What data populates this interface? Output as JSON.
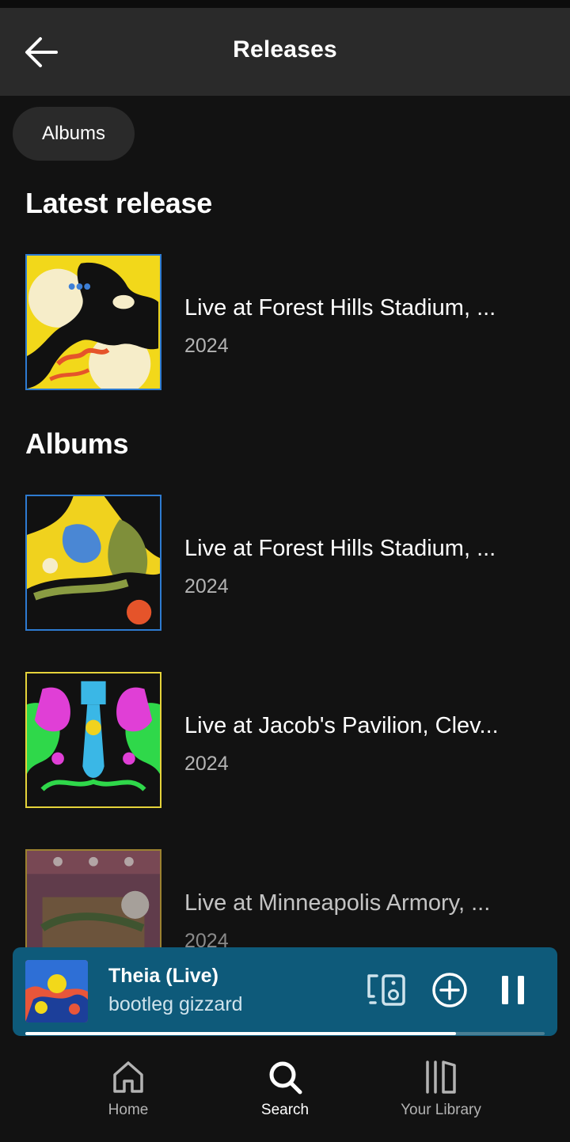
{
  "header": {
    "title": "Releases",
    "back_icon": "arrow-left-icon"
  },
  "filter_chip": {
    "label": "Albums"
  },
  "sections": {
    "latest_title": "Latest release",
    "albums_title": "Albums"
  },
  "latest_release": {
    "title": "Live at Forest Hills Stadium, ...",
    "year": "2024"
  },
  "albums": [
    {
      "title": "Live at Forest Hills Stadium, ...",
      "year": "2024"
    },
    {
      "title": "Live at Jacob's Pavilion, Clev...",
      "year": "2024"
    },
    {
      "title": "Live at Minneapolis Armory, ...",
      "year": "2024"
    }
  ],
  "now_playing": {
    "title": "Theia (Live)",
    "artist": "bootleg gizzard",
    "progress": 0.83,
    "icons": [
      "devices-icon",
      "add-circle-icon",
      "pause-icon"
    ],
    "background": "#0e5a7a"
  },
  "nav": {
    "home": "Home",
    "search": "Search",
    "library": "Your Library",
    "active": "search"
  },
  "colors": {
    "background": "#121212",
    "header": "#2a2a2a",
    "accent_border": "#2e7bd1",
    "secondary_text": "#b3b3b3"
  }
}
